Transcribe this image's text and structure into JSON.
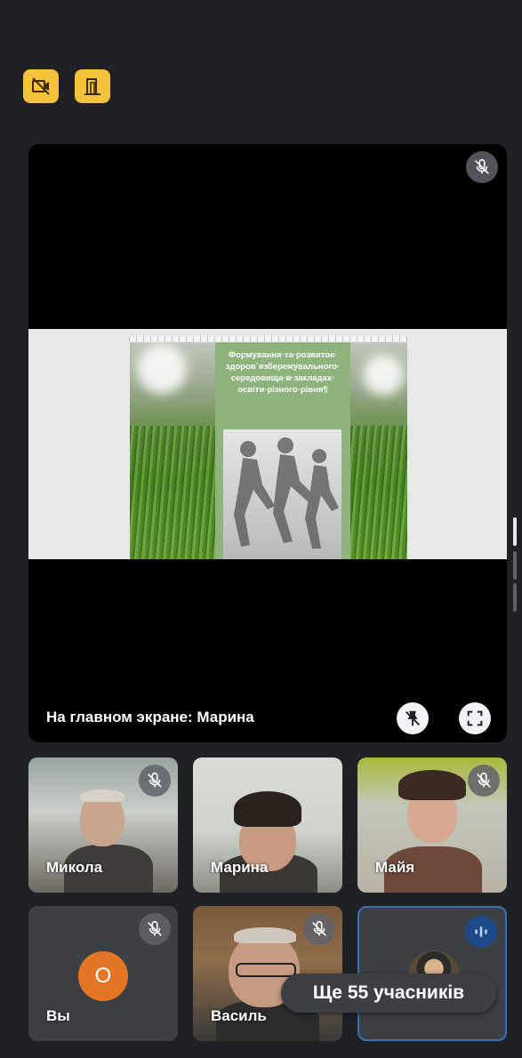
{
  "top_controls": {
    "camera_off_icon": "video-off-icon",
    "door_icon": "door-icon",
    "accent": "#f4c23b"
  },
  "main_stage": {
    "label": "На главном экране: Марина",
    "doc_title": "Формування·та·розвиток·\nздоров`язбережувального·\nсередовища·в·закладах·\nосвіти·різного·рівня¶",
    "pin_icon": "unpin-icon",
    "fullscreen_icon": "fullscreen-icon"
  },
  "participants": [
    {
      "name": "Микола",
      "muted": true
    },
    {
      "name": "Марина",
      "muted": false
    },
    {
      "name": "Майя",
      "muted": true
    },
    {
      "name": "Вы",
      "muted": true,
      "initial": "О"
    },
    {
      "name": "Василь",
      "muted": true
    },
    {
      "name": "",
      "speaking": true
    }
  ],
  "more_participants": "Ще 55 учасників",
  "colors": {
    "background": "#202124",
    "avatar_orange": "#e37626",
    "speaking_blue": "#1f4a8a",
    "active_border": "#3b6fb6"
  }
}
